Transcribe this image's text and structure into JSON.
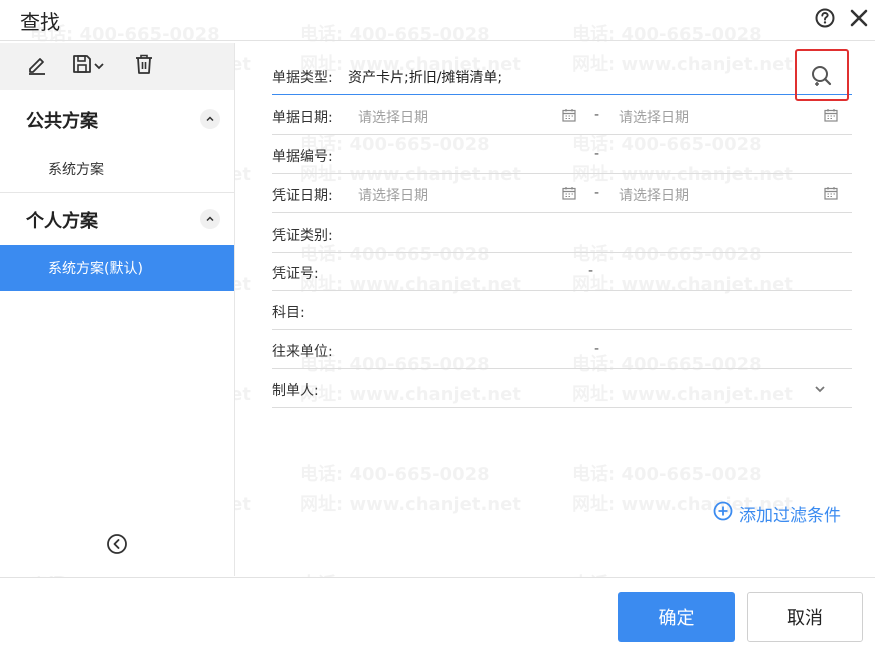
{
  "dialog": {
    "title": "查找",
    "help_icon": "help-circle-icon",
    "close_icon": "close-icon"
  },
  "watermark": {
    "phone": "电话: 400-665-0028",
    "site": "网址: www.chanjet.net"
  },
  "toolbar": {
    "edit_icon": "pencil-icon",
    "save_icon": "save-dropdown-icon",
    "delete_icon": "trash-icon"
  },
  "sidebar": {
    "public_section": {
      "label": "公共方案",
      "items": [
        {
          "label": "系统方案"
        }
      ]
    },
    "personal_section": {
      "label": "个人方案",
      "items": [
        {
          "label": "系统方案(默认)",
          "active": true
        }
      ]
    },
    "collapse_icon": "chevron-left-circle-icon"
  },
  "form": {
    "doc_type": {
      "label": "单据类型:",
      "value": "资产卡片;折旧/摊销清单;"
    },
    "doc_date": {
      "label": "单据日期:",
      "from_placeholder": "请选择日期",
      "to_placeholder": "请选择日期",
      "sep": "-"
    },
    "doc_no": {
      "label": "单据编号:",
      "sep": "-"
    },
    "voucher_date": {
      "label": "凭证日期:",
      "from_placeholder": "请选择日期",
      "to_placeholder": "请选择日期",
      "sep": "-"
    },
    "voucher_type": {
      "label": "凭证类别:"
    },
    "voucher_no": {
      "label": "凭证号:",
      "sep": "-"
    },
    "subject": {
      "label": "科目:"
    },
    "partner": {
      "label": "往来单位:",
      "sep": "-"
    },
    "creator": {
      "label": "制单人:"
    }
  },
  "actions": {
    "add_filter": "添加过滤条件",
    "ok": "确定",
    "cancel": "取消"
  },
  "colors": {
    "accent": "#3b8bf0",
    "highlight_box": "#e03030"
  }
}
